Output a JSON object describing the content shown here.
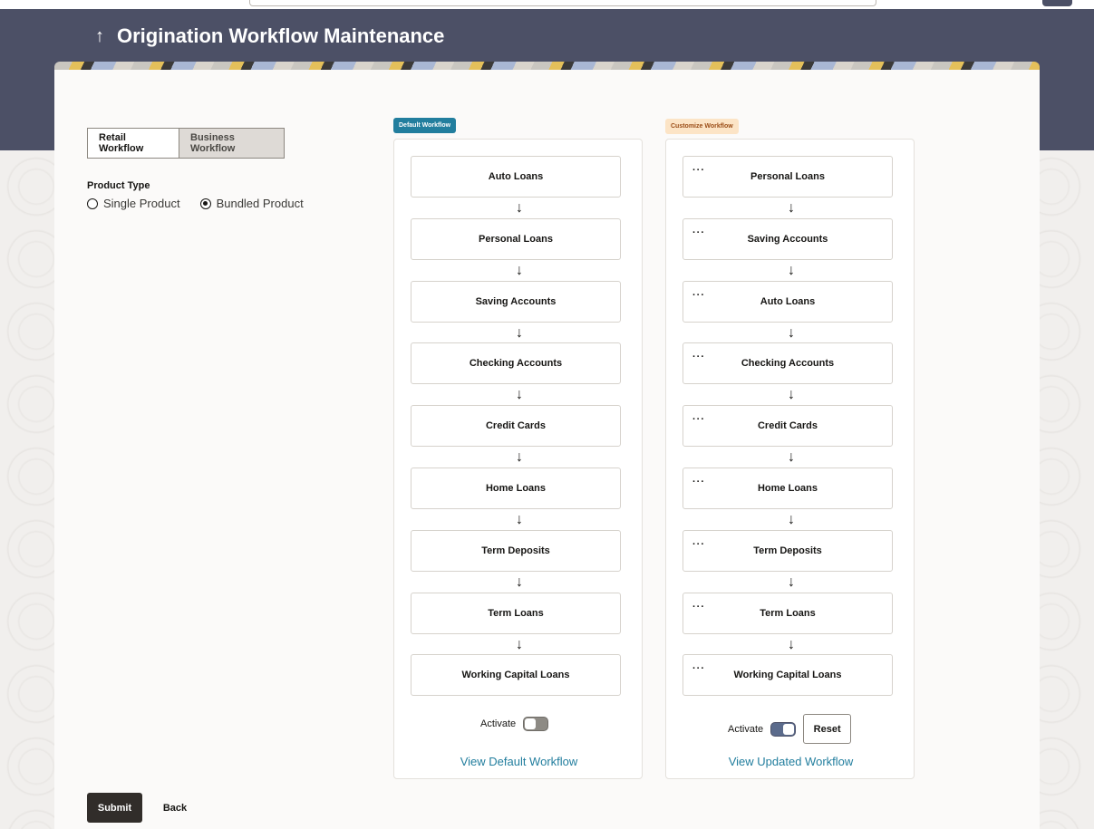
{
  "page": {
    "title": "Origination Workflow Maintenance"
  },
  "tabs": [
    {
      "label": "Retail Workflow",
      "active": true
    },
    {
      "label": "Business Workflow",
      "active": false
    }
  ],
  "product_type": {
    "label": "Product Type",
    "options": [
      {
        "label": "Single Product",
        "checked": false
      },
      {
        "label": "Bundled Product",
        "checked": true
      }
    ]
  },
  "default_workflow": {
    "badge": "Default Workflow",
    "steps": [
      "Auto Loans",
      "Personal Loans",
      "Saving Accounts",
      "Checking Accounts",
      "Credit Cards",
      "Home Loans",
      "Term Deposits",
      "Term Loans",
      "Working Capital Loans"
    ],
    "activate_label": "Activate",
    "activated": false,
    "link_label": "View Default Workflow"
  },
  "custom_workflow": {
    "badge": "Customize Workflow",
    "steps": [
      "Personal Loans",
      "Saving Accounts",
      "Auto Loans",
      "Checking Accounts",
      "Credit Cards",
      "Home Loans",
      "Term Deposits",
      "Term Loans",
      "Working Capital Loans"
    ],
    "activate_label": "Activate",
    "activated": true,
    "reset_label": "Reset",
    "link_label": "View Updated Workflow"
  },
  "actions": {
    "submit_label": "Submit",
    "back_label": "Back"
  },
  "colors": {
    "header_bg": "#4c5066",
    "link": "#227e9e",
    "default_badge": "#227e9e",
    "custom_badge_bg": "#fce4c6"
  },
  "icons": {
    "back": "up-arrow-icon",
    "flow_arrow": "down-arrow-icon",
    "drag_handle": "more-dots-icon"
  }
}
